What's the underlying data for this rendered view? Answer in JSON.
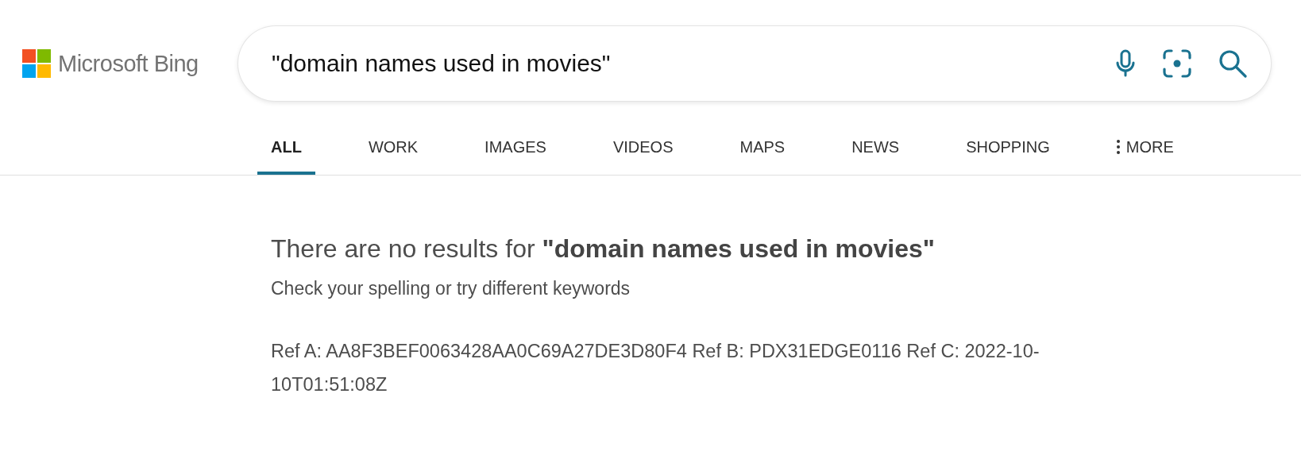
{
  "logo": {
    "text": "Microsoft Bing"
  },
  "search": {
    "value": "\"domain names used in movies\""
  },
  "tabs": [
    {
      "label": "ALL",
      "selected": true
    },
    {
      "label": "WORK",
      "selected": false
    },
    {
      "label": "IMAGES",
      "selected": false
    },
    {
      "label": "VIDEOS",
      "selected": false
    },
    {
      "label": "MAPS",
      "selected": false
    },
    {
      "label": "NEWS",
      "selected": false
    },
    {
      "label": "SHOPPING",
      "selected": false
    },
    {
      "label": "MORE",
      "selected": false,
      "kind": "more"
    }
  ],
  "message": {
    "heading": "There are no results for **\"domain names used in movies\"**",
    "hint": "Check your spelling or try different keywords",
    "reference": "Ref A: AA8F3BEF0063428AA0C69A27DE3D80F4 Ref B: PDX31EDGE0116 Ref C: 2022-10-10T01:51:08Z"
  }
}
